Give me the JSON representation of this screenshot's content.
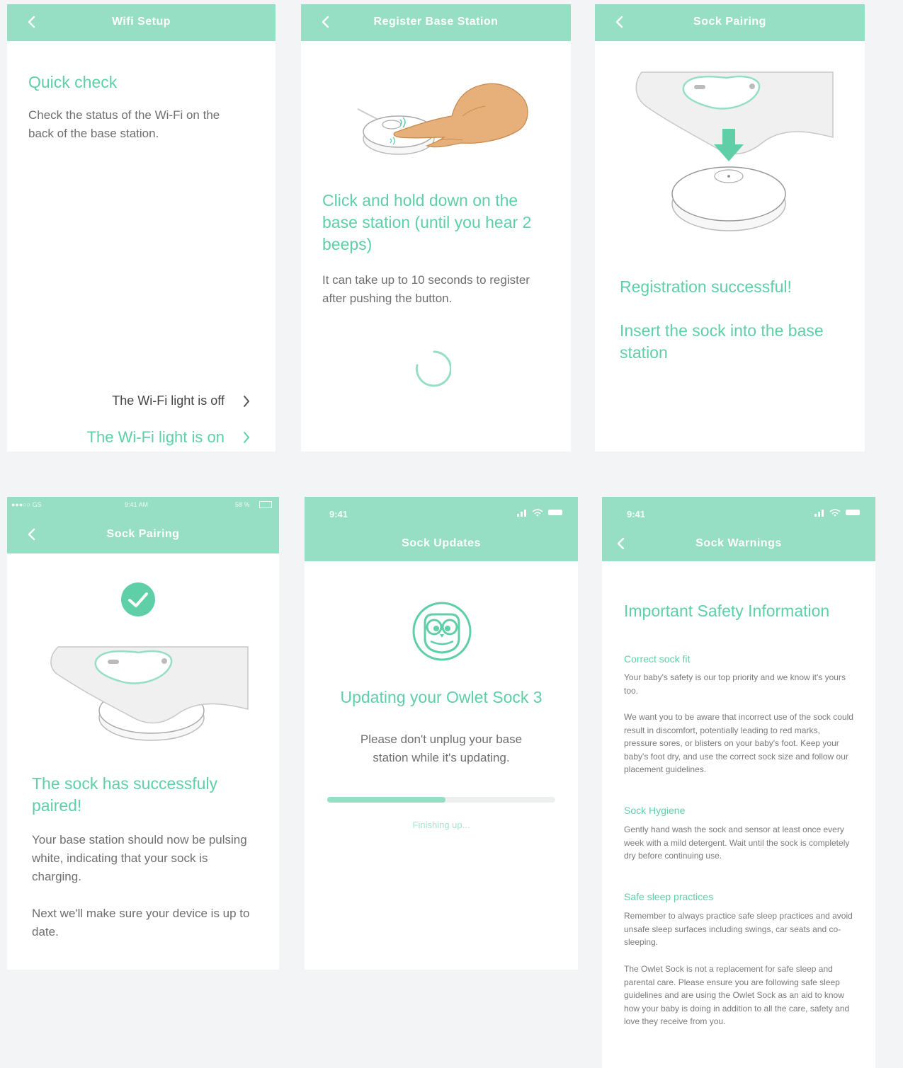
{
  "colors": {
    "accent": "#96dfc4",
    "accent_text": "#5ecfa6",
    "body_text": "#6f6f6f",
    "bg": "#f3f4f6"
  },
  "wifi_setup": {
    "title": "Wifi Setup",
    "heading": "Quick check",
    "body": "Check the status of the Wi-Fi on the back of the base station.",
    "option_off": "The Wi-Fi light is off",
    "option_on": "The Wi-Fi light is on"
  },
  "register": {
    "title": "Register Base Station",
    "heading": "Click and hold down on the base station (until you hear 2 beeps)",
    "body": "It can take up to 10 seconds to register after pushing the button."
  },
  "pairing_a": {
    "title": "Sock Pairing",
    "success": "Registration successful!",
    "instruction": "Insert the sock into the base station"
  },
  "pairing_b": {
    "status_carrier": "●●●○○ GS",
    "status_time": "9:41 AM",
    "status_battery": "58 %",
    "title": "Sock Pairing",
    "heading": "The sock has successfuly paired!",
    "body1": "Your base station should now be pulsing white, indicating that your sock is charging.",
    "body2": "Next we'll make sure your device is up to date."
  },
  "updates": {
    "status_time": "9:41",
    "title": "Sock Updates",
    "heading": "Updating your Owlet Sock 3",
    "body": "Please don't unplug your base station while it's updating.",
    "progress": 0.52,
    "progress_label": "Finishing up..."
  },
  "warnings": {
    "status_time": "9:41",
    "title": "Sock Warnings",
    "heading": "Important Safety Information",
    "s1_title": "Correct sock fit",
    "s1_p1": "Your baby's safety is our top priority and we know it's yours too.",
    "s1_p2": "We want you to be aware that incorrect use of the sock could result in discomfort, potentially leading to red marks, pressure sores, or blisters on your baby's foot. Keep your baby's foot dry, and use the correct sock size and follow our placement guidelines.",
    "s2_title": "Sock Hygiene",
    "s2_p1": "Gently hand wash the sock and sensor at least once every week with a mild detergent. Wait until the sock is completely dry before continuing use.",
    "s3_title": "Safe sleep practices",
    "s3_p1": "Remember to always practice safe sleep practices and avoid unsafe sleep surfaces including swings, car seats and co-sleeping.",
    "s3_p2": "The Owlet Sock is not a replacement for safe sleep and parental care. Please ensure you are following safe sleep guidelines and are using the Owlet Sock as an aid to know how your baby is doing in addition to all the care, safety and love they receive from you."
  }
}
